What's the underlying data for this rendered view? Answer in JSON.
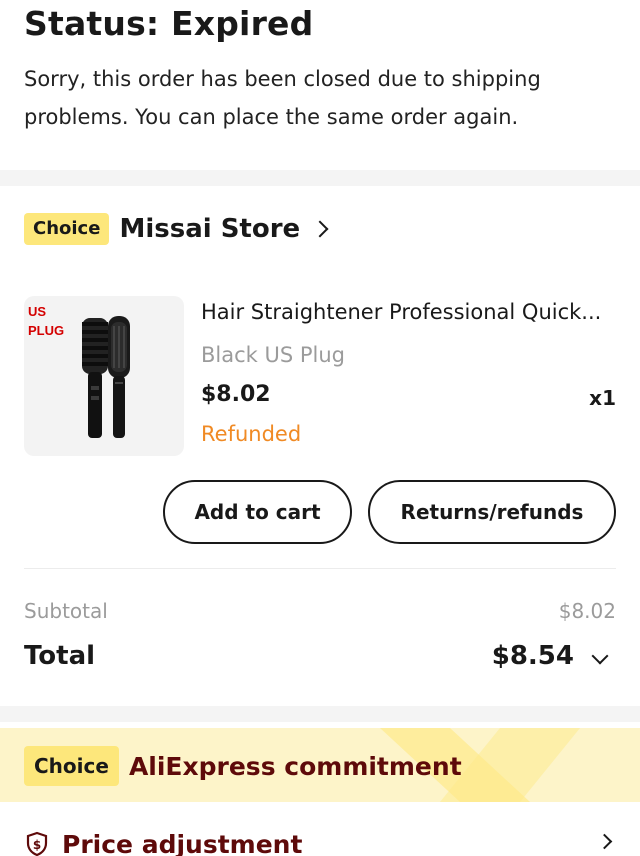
{
  "status": {
    "title": "Status: Expired",
    "message": "Sorry, this order has been closed due to shipping problems. You can place the same order again."
  },
  "store": {
    "badge": "Choice",
    "name": "Missai Store"
  },
  "product": {
    "image_label_line1": "US",
    "image_label_line2": "PLUG",
    "title": "Hair Straightener Professional Quick...",
    "variant": "Black US Plug",
    "price": "$8.02",
    "quantity": "x1",
    "status": "Refunded"
  },
  "actions": {
    "add_to_cart": "Add to cart",
    "returns": "Returns/refunds"
  },
  "summary": {
    "subtotal_label": "Subtotal",
    "subtotal_value": "$8.02",
    "total_label": "Total",
    "total_value": "$8.54"
  },
  "commitment": {
    "badge": "Choice",
    "title": "AliExpress commitment",
    "price_adjustment": "Price adjustment"
  },
  "colors": {
    "choice_yellow": "#fde77b",
    "refunded_orange": "#f08a24",
    "commitment_text": "#5e0a0a"
  }
}
